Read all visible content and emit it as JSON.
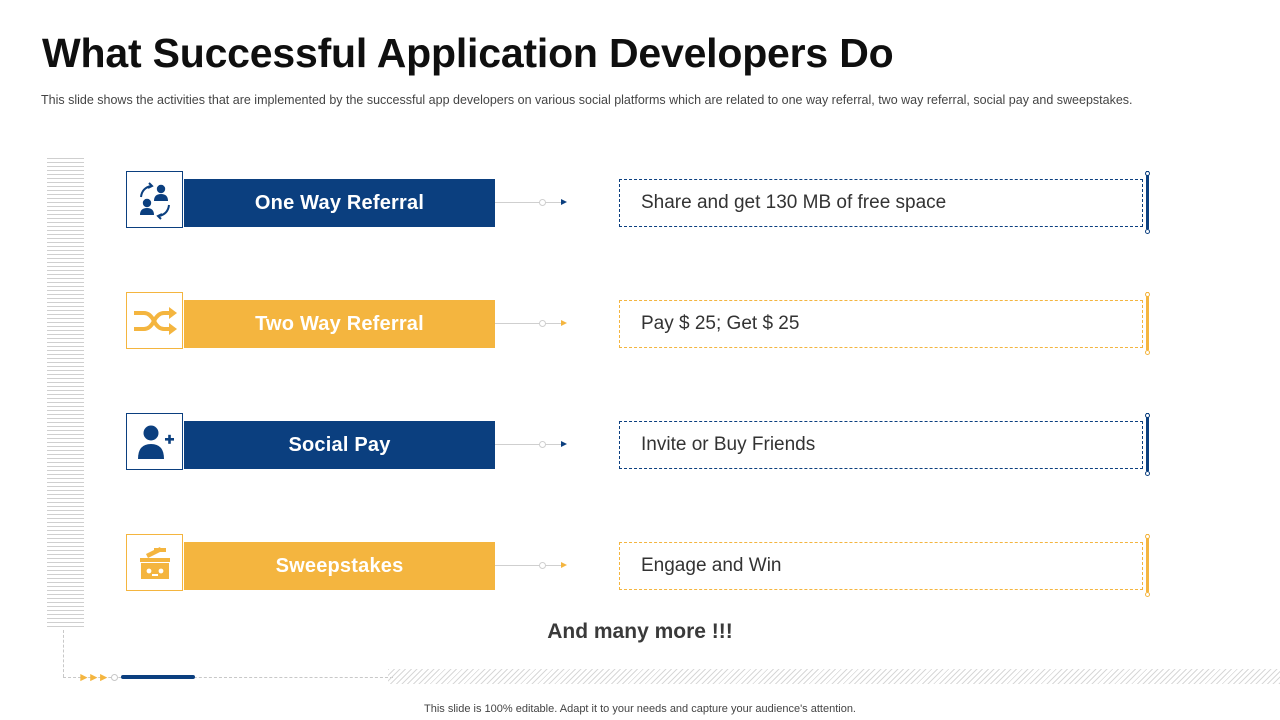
{
  "slide": {
    "title": "What Successful Application Developers Do",
    "subtitle": "This slide shows the activities that are implemented by the successful app developers on various social platforms which are related to one way referral, two way referral, social pay and sweepstakes."
  },
  "colors": {
    "primary": "#0b3f7f",
    "accent": "#f4b53f"
  },
  "items": [
    {
      "label": "One Way Referral",
      "description": "Share and get 130 MB of free space",
      "icon": "people-exchange-icon",
      "color": "blue"
    },
    {
      "label": "Two Way Referral",
      "description": "Pay $ 25; Get $ 25",
      "icon": "shuffle-arrows-icon",
      "color": "yellow"
    },
    {
      "label": "Social Pay",
      "description": "Invite or Buy Friends",
      "icon": "add-user-icon",
      "color": "blue"
    },
    {
      "label": "Sweepstakes",
      "description": "Engage and Win",
      "icon": "prize-box-icon",
      "color": "yellow"
    }
  ],
  "closing": "And many more !!!",
  "footer": "This slide is 100% editable. Adapt it to your needs and capture your audience's attention."
}
